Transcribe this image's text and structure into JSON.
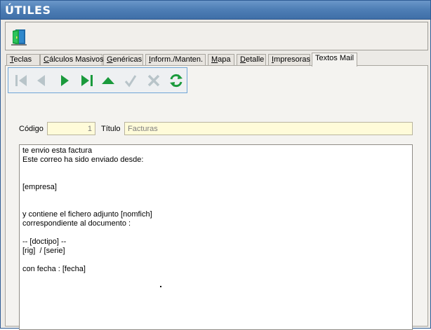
{
  "window": {
    "title": "ÚTILES"
  },
  "colors": {
    "accent": "#1a9a3c",
    "disabled": "#b8c4c9",
    "titlebar": "#4f7fb6",
    "field_bg": "#fffbd9"
  },
  "toolbar": {
    "exit_icon": "exit-door-icon"
  },
  "tabs": [
    {
      "label": "Teclas",
      "ul": "T",
      "rest": "eclas"
    },
    {
      "label": "Cálculos Masivos",
      "ul": "C",
      "rest": "álculos Masivos"
    },
    {
      "label": "Genéricas",
      "ul": "G",
      "rest": "enéricas"
    },
    {
      "label": "Inform./Manten.",
      "ul": "I",
      "rest": "nform./Manten."
    },
    {
      "label": "Mapa",
      "ul": "M",
      "rest": "apa"
    },
    {
      "label": "Detalle",
      "ul": "D",
      "rest": "etalle"
    },
    {
      "label": "Impresoras",
      "ul": "I",
      "rest": "mpresoras"
    },
    {
      "label": "Textos Mail",
      "ul": "",
      "rest": "Textos Mail",
      "active": true
    }
  ],
  "nav": {
    "buttons": [
      {
        "icon": "first-record-icon",
        "enabled": false
      },
      {
        "icon": "previous-record-icon",
        "enabled": false
      },
      {
        "icon": "next-record-icon",
        "enabled": true
      },
      {
        "icon": "last-record-icon",
        "enabled": true
      },
      {
        "icon": "insert-record-icon",
        "enabled": true
      },
      {
        "icon": "post-check-icon",
        "enabled": false
      },
      {
        "icon": "cancel-x-icon",
        "enabled": false
      },
      {
        "icon": "refresh-icon",
        "enabled": true
      }
    ]
  },
  "form": {
    "codigo_label": "Código",
    "codigo_value": "1",
    "titulo_label": "Título",
    "titulo_value": "Facturas"
  },
  "body_text": [
    "te envio esta factura",
    "Este correo ha sido enviado desde:",
    "",
    "",
    "[empresa]",
    "",
    "",
    "y contiene el fichero adjunto [nomfich]",
    "correspondiente al documento :",
    "",
    "-- [doctipo] --",
    "[rig]  / [serie]",
    "",
    "con fecha : [fecha]"
  ]
}
